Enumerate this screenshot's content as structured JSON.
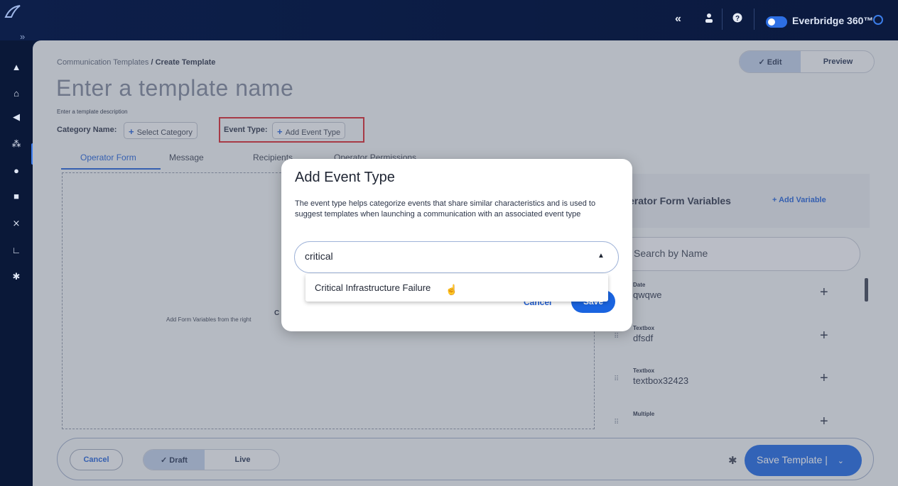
{
  "topbar": {
    "collapse_icon": "«",
    "brand": "Everbridge 360™"
  },
  "breadcrumb": {
    "parent": "Communication Templates",
    "separator": "/",
    "current": "Create Template"
  },
  "template": {
    "name_placeholder": "Enter a template name",
    "description_placeholder": "Enter a template description",
    "category_label": "Category Name:",
    "category_button": "Select Category",
    "event_type_label": "Event Type:",
    "event_type_button": "Add Event Type"
  },
  "view_toggle": {
    "edit": "✓  Edit",
    "preview": "Preview"
  },
  "tabs": [
    "Operator Form",
    "Message",
    "Recipients",
    "Operator Permissions"
  ],
  "dropzone": {
    "title": "C",
    "subtitle": "Add Form Variables from the right"
  },
  "variables": {
    "title": "erator Form Variables",
    "add_label": "+ Add Variable",
    "search_placeholder": "Search by Name",
    "items": [
      {
        "type": "Date",
        "name": "qwqwe"
      },
      {
        "type": "Textbox",
        "name": "dfsdf"
      },
      {
        "type": "Textbox",
        "name": "textbox32423"
      },
      {
        "type": "Multiple",
        "name": ""
      }
    ]
  },
  "footer": {
    "cancel": "Cancel",
    "draft": "✓  Draft",
    "live": "Live",
    "save_template": "Save Template",
    "divider": "|"
  },
  "modal": {
    "title": "Add Event Type",
    "description": "The event type helps categorize events that share similar characteristics and is used to suggest templates when launching a communication with an associated event type",
    "input_value": "critical",
    "cancel": "Cancel",
    "save": "Save",
    "options": [
      "Critical Infrastructure Failure"
    ]
  }
}
